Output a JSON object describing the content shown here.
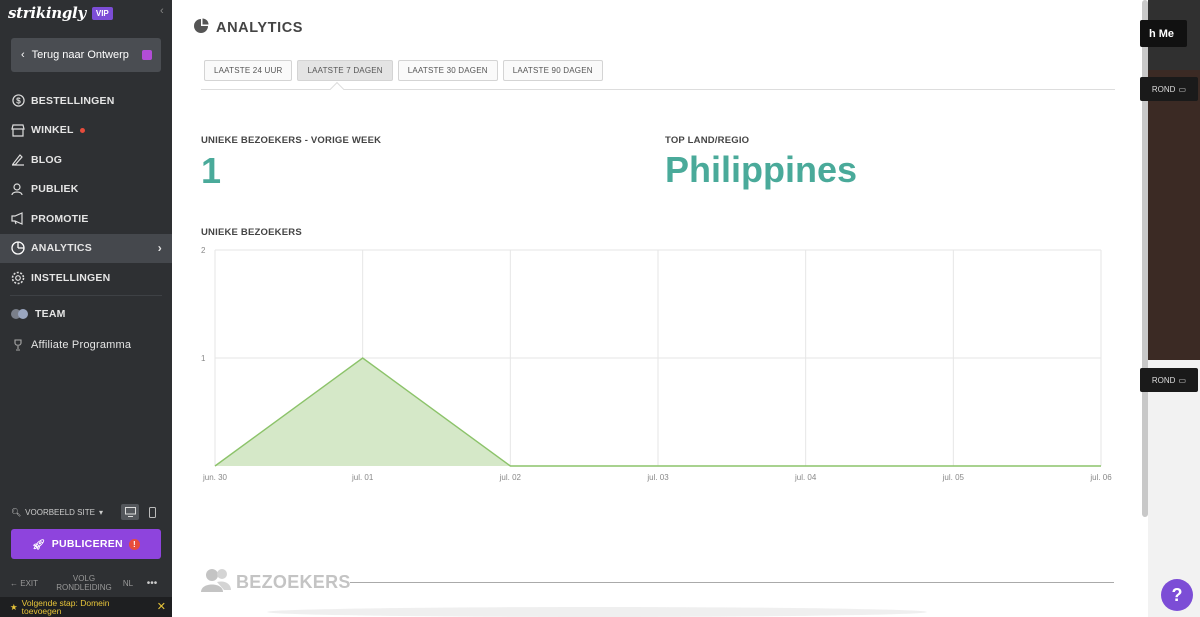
{
  "sidebar": {
    "brand": "strikingly",
    "vip_badge": "VIP",
    "back_button": "Terug naar Ontwerp",
    "nav": [
      {
        "label": "BESTELLINGEN",
        "icon": "dollar-circle-icon"
      },
      {
        "label": "WINKEL",
        "icon": "store-icon",
        "badge": "red-dot"
      },
      {
        "label": "BLOG",
        "icon": "pen-icon"
      },
      {
        "label": "PUBLIEK",
        "icon": "people-icon"
      },
      {
        "label": "PROMOTIE",
        "icon": "megaphone-icon"
      },
      {
        "label": "ANALYTICS",
        "icon": "pie-chart-icon",
        "active": true
      },
      {
        "label": "INSTELLINGEN",
        "icon": "gear-icon"
      },
      {
        "label": "TEAM",
        "icon": "team-avatars-icon"
      },
      {
        "label": "Affiliate Programma",
        "icon": "trophy-icon"
      }
    ],
    "preview_label": "VOORBEELD SITE",
    "publish_button": "PUBLICEREN",
    "publish_alert": "!",
    "exit_label": "EXIT",
    "tour_label": "VOLG RONDLEIDING",
    "language": "NL",
    "more": "•••",
    "next_step": "Volgende stap: Domein toevoegen"
  },
  "main": {
    "title": "ANALYTICS",
    "tabs": [
      {
        "label": "LAATSTE 24 UUR",
        "active": false
      },
      {
        "label": "LAATSTE 7 DAGEN",
        "active": true
      },
      {
        "label": "LAATSTE 30 DAGEN",
        "active": false
      },
      {
        "label": "LAATSTE 90 DAGEN",
        "active": false
      }
    ],
    "unique_visitors_label": "UNIEKE BEZOEKERS - VORIGE WEEK",
    "unique_visitors_value": "1",
    "top_country_label": "TOP LAND/REGIO",
    "top_country_value": "Philippines",
    "chart_title": "UNIEKE BEZOEKERS",
    "section_title": "BEZOEKERS"
  },
  "chart_data": {
    "type": "area",
    "title": "UNIEKE BEZOEKERS",
    "categories": [
      "jun. 30",
      "jul. 01",
      "jul. 02",
      "jul. 03",
      "jul. 04",
      "jul. 05",
      "jul. 06"
    ],
    "values": [
      0,
      1,
      0,
      0,
      0,
      0,
      0
    ],
    "y_ticks": [
      "2",
      "1"
    ],
    "ylim": [
      0,
      2
    ],
    "grid": true,
    "fill_color": "#d5e8c8",
    "line_color": "#8cc36a"
  },
  "preview": {
    "contact_button": "h Me",
    "background_button": "ROND"
  },
  "help_button": "?",
  "colors": {
    "accent": "#8e44dd",
    "value_teal": "#4aaa9a",
    "sidebar_bg": "#2e3033"
  }
}
